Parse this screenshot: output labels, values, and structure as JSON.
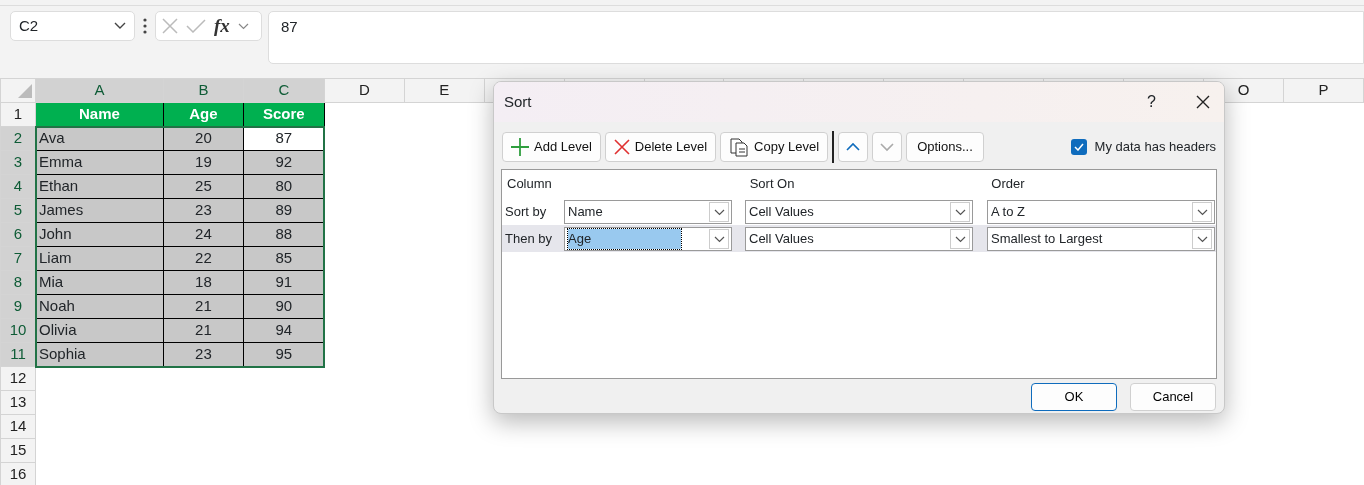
{
  "formula_bar": {
    "name_box": "C2",
    "formula_button": "fx",
    "formula": "87"
  },
  "sheet": {
    "columns_left": [
      {
        "label": "A",
        "selected": true
      },
      {
        "label": "B",
        "selected": true
      },
      {
        "label": "C",
        "selected": true
      },
      {
        "label": "D",
        "selected": false
      },
      {
        "label": "E",
        "selected": false
      }
    ],
    "columns_right": [
      {
        "label": "O",
        "selected": false
      },
      {
        "label": "P",
        "selected": false
      }
    ],
    "header_row": {
      "header": "1",
      "cells": [
        "Name",
        "Age",
        "Score"
      ]
    },
    "rows": [
      {
        "header": "2",
        "selected": true,
        "cells": [
          {
            "text": "Ava",
            "active": false
          },
          {
            "text": "20",
            "active": false
          },
          {
            "text": "87",
            "active": true
          }
        ]
      },
      {
        "header": "3",
        "selected": true,
        "cells": [
          {
            "text": "Emma",
            "active": false
          },
          {
            "text": "19",
            "active": false
          },
          {
            "text": "92",
            "active": false
          }
        ]
      },
      {
        "header": "4",
        "selected": true,
        "cells": [
          {
            "text": "Ethan",
            "active": false
          },
          {
            "text": "25",
            "active": false
          },
          {
            "text": "80",
            "active": false
          }
        ]
      },
      {
        "header": "5",
        "selected": true,
        "cells": [
          {
            "text": "James",
            "active": false
          },
          {
            "text": "23",
            "active": false
          },
          {
            "text": "89",
            "active": false
          }
        ]
      },
      {
        "header": "6",
        "selected": true,
        "cells": [
          {
            "text": "John",
            "active": false
          },
          {
            "text": "24",
            "active": false
          },
          {
            "text": "88",
            "active": false
          }
        ]
      },
      {
        "header": "7",
        "selected": true,
        "cells": [
          {
            "text": "Liam",
            "active": false
          },
          {
            "text": "22",
            "active": false
          },
          {
            "text": "85",
            "active": false
          }
        ]
      },
      {
        "header": "8",
        "selected": true,
        "cells": [
          {
            "text": "Mia",
            "active": false
          },
          {
            "text": "18",
            "active": false
          },
          {
            "text": "91",
            "active": false
          }
        ]
      },
      {
        "header": "9",
        "selected": true,
        "cells": [
          {
            "text": "Noah",
            "active": false
          },
          {
            "text": "21",
            "active": false
          },
          {
            "text": "90",
            "active": false
          }
        ]
      },
      {
        "header": "10",
        "selected": true,
        "cells": [
          {
            "text": "Olivia",
            "active": false
          },
          {
            "text": "21",
            "active": false
          },
          {
            "text": "94",
            "active": false
          }
        ]
      },
      {
        "header": "11",
        "selected": true,
        "cells": [
          {
            "text": "Sophia",
            "active": false
          },
          {
            "text": "23",
            "active": false
          },
          {
            "text": "95",
            "active": false
          }
        ]
      }
    ],
    "empty_rows": [
      "12",
      "13",
      "14",
      "15",
      "16"
    ]
  },
  "dialog": {
    "title": "Sort",
    "help": "?",
    "toolbar": [
      {
        "kind": "add",
        "label": "Add Level"
      },
      {
        "kind": "delete",
        "label": "Delete Level"
      },
      {
        "kind": "copy",
        "label": "Copy Level"
      },
      {
        "kind": "up",
        "disabled": false
      },
      {
        "kind": "down",
        "disabled": true
      },
      {
        "kind": "options",
        "label": "Options..."
      }
    ],
    "headers_checkbox": {
      "label": "My data has headers",
      "checked": true
    },
    "grid_headers": [
      "Column",
      "Sort On",
      "Order"
    ],
    "levels": [
      {
        "label": "Sort by",
        "column": "Name",
        "sort_on": "Cell Values",
        "order": "A to Z",
        "selected": false
      },
      {
        "label": "Then by",
        "column": "Age",
        "sort_on": "Cell Values",
        "order": "Smallest to Largest",
        "selected": true
      }
    ],
    "buttons": [
      {
        "label": "OK",
        "default": true
      },
      {
        "label": "Cancel",
        "default": false
      }
    ]
  }
}
